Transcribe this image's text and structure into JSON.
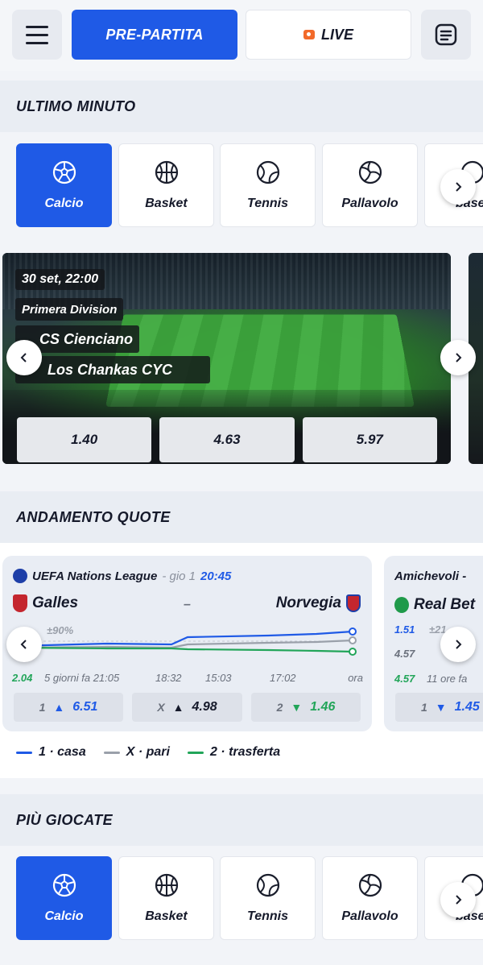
{
  "header": {
    "prematch_label": "PRE-PARTITA",
    "live_label": "LIVE"
  },
  "sections": {
    "last_minute": "ULTIMO MINUTO",
    "odds_trend": "ANDAMENTO QUOTE",
    "most_played": "PIÙ GIOCATE"
  },
  "sports": [
    {
      "label": "Calcio",
      "icon": "soccer-ball-icon"
    },
    {
      "label": "Basket",
      "icon": "basketball-icon"
    },
    {
      "label": "Tennis",
      "icon": "tennis-ball-icon"
    },
    {
      "label": "Pallavolo",
      "icon": "volleyball-icon"
    },
    {
      "label": "basel",
      "icon": "baseball-icon"
    }
  ],
  "featured_match": {
    "datetime": "30 set, 22:00",
    "league": "Primera Division",
    "home": "CS Cienciano",
    "away": "Los Chankas CYC",
    "odds": [
      "1.40",
      "4.63",
      "5.97"
    ]
  },
  "trend_cards": [
    {
      "competition": "UEFA Nations League",
      "day": "- gio 1",
      "time": "20:45",
      "home": "Galles",
      "separator": "–",
      "away": "Norvegia",
      "change": "±90%",
      "open_odd": "2.04",
      "time_labels": [
        "5 giorni fa 21:05",
        "18:32",
        "15:03",
        "17:02",
        "ora"
      ],
      "odds": [
        {
          "sign": "1",
          "dir": "▲",
          "value": "6.51",
          "color": "#1f5ae6"
        },
        {
          "sign": "X",
          "dir": "▲",
          "value": "4.98",
          "color": "#15192a"
        },
        {
          "sign": "2",
          "dir": "▼",
          "value": "1.46",
          "color": "#22a559"
        }
      ]
    },
    {
      "competition": "Amichevoli -",
      "home": "Real Bet",
      "odd_a": "1.51",
      "change": "±21",
      "odd_b": "4.57",
      "open_odd": "4.57",
      "time_label": "11 ore fa",
      "odds": [
        {
          "sign": "1",
          "dir": "▼",
          "value": "1.45",
          "color": "#1f5ae6"
        }
      ]
    }
  ],
  "legend": [
    {
      "label": "1 · casa",
      "color": "#1f5ae6"
    },
    {
      "label": "X · pari",
      "color": "#9aa0aa"
    },
    {
      "label": "2 · trasferta",
      "color": "#22a559"
    }
  ],
  "colors": {
    "accent": "#1f5ae6",
    "live": "#f26a2a",
    "green": "#22a559"
  }
}
